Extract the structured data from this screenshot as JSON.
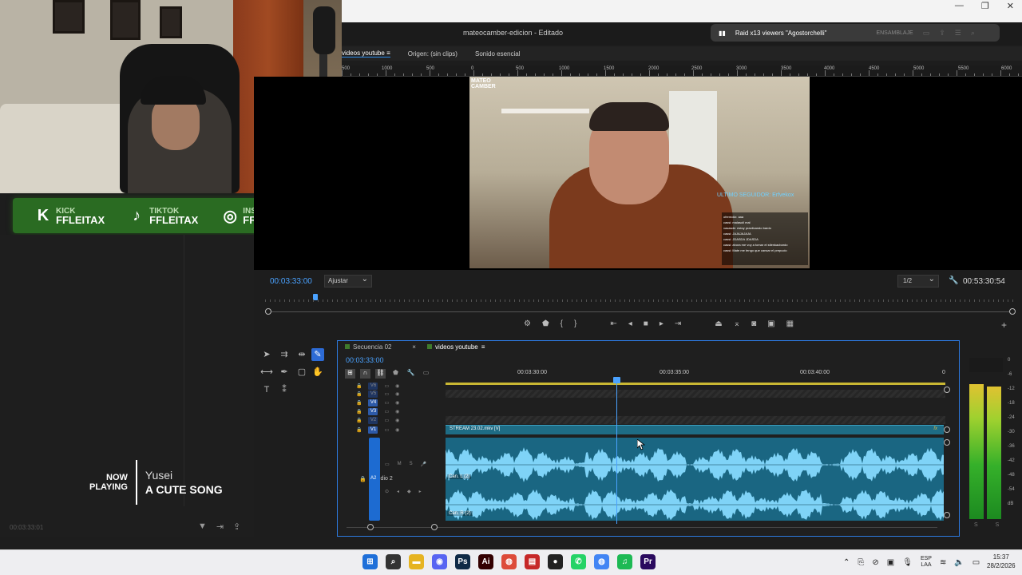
{
  "app": {
    "title": "mateocamber-edicion - Editado",
    "window_controls": [
      "—",
      "❐",
      "✕"
    ],
    "accent": "#2d8ceb"
  },
  "raid": {
    "text": "Raid x13 viewers \"Agostorchelli\"",
    "mode": "ENSAMBLAJE"
  },
  "tabs": [
    {
      "label": "videos youtube",
      "active": true
    },
    {
      "label": "Origen: (sin clips)",
      "active": false
    },
    {
      "label": "Sonido esencial",
      "active": false
    }
  ],
  "social": [
    {
      "icon": "kick-icon",
      "glyph": "K",
      "network": "KICK",
      "handle": "FFLEITAX"
    },
    {
      "icon": "tiktok-icon",
      "glyph": "♪",
      "network": "TIKTOK",
      "handle": "FFLEITAX"
    },
    {
      "icon": "instagram-icon",
      "glyph": "◎",
      "network": "INSTAGRAM",
      "handle": "FFLEITAX"
    }
  ],
  "now_playing": {
    "label_line1": "NOW",
    "label_line2": "PLAYING",
    "artist": "Yusei",
    "song": "A CUTE SONG"
  },
  "left_timecode": "00:03:33:01",
  "ruler_labels": [
    "500",
    "1000",
    "500",
    "0",
    "500",
    "1000",
    "1500",
    "2000",
    "2500",
    "3000",
    "3500",
    "4000",
    "4500",
    "5000",
    "5500",
    "6000"
  ],
  "video_overlay": {
    "logo_line1": "MATEO",
    "logo_line2": "CAMBER",
    "follow_text": "ULTIMO SEGUIDOR: Erfvekox",
    "chat_lines": [
      "ofermoliz: aaa",
      "cassi: malasoli mal",
      "xasasde: estoy practicando bardo",
      "cassi: JAJAJAJAJA",
      "cassi: JDASDA JDASDA",
      "cassi: ahora me voy a tomar el stlenkacbardo",
      "cassi: Mate me tengo que cansar el prepucio"
    ]
  },
  "program": {
    "timecode": "00:03:33:00",
    "fit": "Ajustar",
    "resolution": "1/2",
    "duration": "00:53:30:54"
  },
  "timeline": {
    "tabs": [
      {
        "label": "Secuencia 02",
        "active": false
      },
      {
        "label": "videos youtube",
        "active": true
      }
    ],
    "timecode": "00:03:33:00",
    "ruler": [
      "00:03:30:00",
      "00:03:35:00",
      "00:03:40:00",
      "0"
    ],
    "tracks": [
      "V6",
      "V5",
      "V4",
      "V3",
      "V2",
      "V1"
    ],
    "video_clip": "STREAM 23.02.mkv [V]",
    "audio_track": "A2",
    "audio_name": "Audio 2",
    "channels": [
      "Can. L (2)",
      "Can. R (2)"
    ]
  },
  "meter": {
    "labels": [
      "0",
      "-6",
      "-12",
      "-18",
      "-24",
      "-30",
      "-36",
      "-42",
      "-48",
      "-54",
      "dB"
    ],
    "bottom": [
      "S",
      "S"
    ],
    "level_left": 0.92,
    "level_right": 0.9
  },
  "taskbar": {
    "apps": [
      {
        "name": "windows-start-icon",
        "glyph": "⊞",
        "color": "#1e6fd9"
      },
      {
        "name": "search-icon",
        "glyph": "⌕",
        "color": "#333333"
      },
      {
        "name": "file-explorer-icon",
        "glyph": "▬",
        "color": "#e6b422"
      },
      {
        "name": "discord-icon",
        "glyph": "◉",
        "color": "#5865f2"
      },
      {
        "name": "photoshop-icon",
        "glyph": "Ps",
        "color": "#0f2a46"
      },
      {
        "name": "illustrator-icon",
        "glyph": "Ai",
        "color": "#330000"
      },
      {
        "name": "chrome-icon",
        "glyph": "◍",
        "color": "#dd4b39"
      },
      {
        "name": "recorder-icon",
        "glyph": "▤",
        "color": "#c62828"
      },
      {
        "name": "obs-icon",
        "glyph": "●",
        "color": "#222222"
      },
      {
        "name": "whatsapp-icon",
        "glyph": "✆",
        "color": "#25d366"
      },
      {
        "name": "chrome-profile-icon",
        "glyph": "◍",
        "color": "#4285f4"
      },
      {
        "name": "spotify-icon",
        "glyph": "♫",
        "color": "#1db954"
      },
      {
        "name": "premiere-icon",
        "glyph": "Pr",
        "color": "#2a0a5e"
      }
    ],
    "lang_line1": "ESP",
    "lang_line2": "LAA",
    "time": "15:37",
    "date": "28/2/2026"
  }
}
